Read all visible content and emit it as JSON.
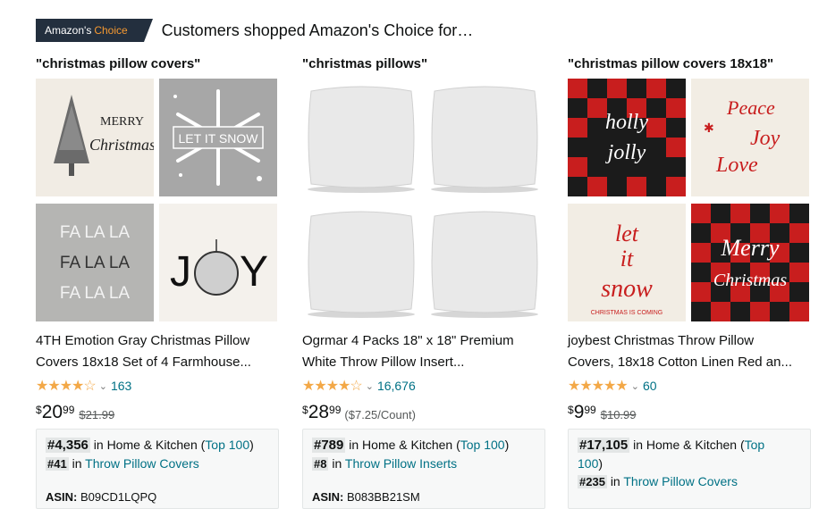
{
  "header": {
    "badge_prefix": "Amazon's",
    "badge_choice": "Choice",
    "text": "Customers shopped Amazon's Choice for…"
  },
  "colors": {
    "badge_bg": "#232f3e",
    "choice_orange": "#f69931",
    "link": "#007185",
    "star": "#f3a847"
  },
  "columns": [
    {
      "query": "\"christmas pillow covers\"",
      "tile_texts": [
        "MERRY",
        "Christmas",
        "LET IT SNOW",
        "FA LA LA",
        "FA LA LA",
        "FA LA LA",
        "J",
        "Y"
      ],
      "title_line1": "4TH Emotion Gray Christmas Pillow",
      "title_line2": "Covers 18x18 Set of 4 Farmhouse...",
      "stars": "★★★★☆",
      "rating_count": "163",
      "price_symbol": "$",
      "price_whole": "20",
      "price_fraction": "99",
      "list_price": "$21.99",
      "rank_main": "#4,356",
      "rank_main_in": "in Home & Kitchen (",
      "rank_main_link": "Top 100",
      "rank_main_close": ")",
      "rank_sub": "#41",
      "rank_sub_in": "in",
      "rank_sub_link": "Throw Pillow Covers",
      "asin_label": "ASIN:",
      "asin": "B09CD1LQPQ"
    },
    {
      "query": "\"christmas pillows\"",
      "title_line1": "Ogrmar 4 Packs 18\" x 18\" Premium",
      "title_line2": "White Throw Pillow Insert...",
      "stars": "★★★★☆",
      "rating_count": "16,676",
      "price_symbol": "$",
      "price_whole": "28",
      "price_fraction": "99",
      "unit_price": "($7.25/Count)",
      "rank_main": "#789",
      "rank_main_in": "in Home & Kitchen (",
      "rank_main_link": "Top 100",
      "rank_main_close": ")",
      "rank_sub": "#8",
      "rank_sub_in": "in",
      "rank_sub_link": "Throw Pillow Inserts",
      "asin_label": "ASIN:",
      "asin": "B083BB21SM"
    },
    {
      "query": "\"christmas pillow covers 18x18\"",
      "tile_texts": [
        "holly",
        "jolly",
        "Peace",
        "Joy",
        "Love",
        "let",
        "it",
        "snow",
        "CHRISTMAS IS COMING",
        "Merry",
        "Christmas"
      ],
      "title_line1": "joybest Christmas Throw Pillow",
      "title_line2": "Covers, 18x18 Cotton Linen Red an...",
      "stars": "★★★★★",
      "rating_count": "60",
      "price_symbol": "$",
      "price_whole": "9",
      "price_fraction": "99",
      "list_price": "$10.99",
      "rank_main": "#17,105",
      "rank_main_in": "in Home & Kitchen (",
      "rank_main_link": "Top",
      "rank_main_link2": "100",
      "rank_main_close": ")",
      "rank_sub": "#235",
      "rank_sub_in": "in",
      "rank_sub_link": "Throw Pillow Covers"
    }
  ]
}
